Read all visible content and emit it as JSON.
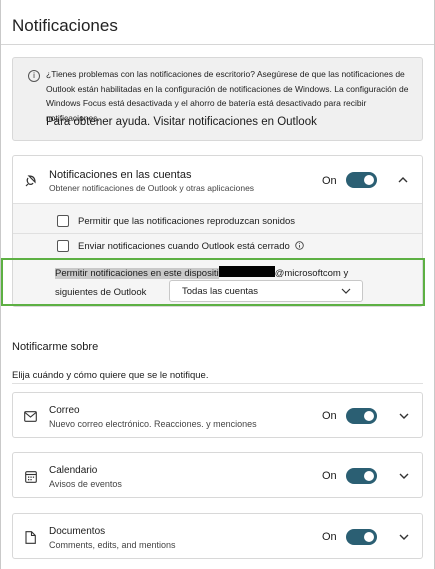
{
  "page": {
    "title": "Notificaciones"
  },
  "info_banner": {
    "icon": "info-icon",
    "text": "¿Tienes problemas con las notificaciones de escritorio? Asegúrese de que las notificaciones de Outlook están habilitadas en la configuración de notificaciones de Windows. La configuración de Windows Focus está desactivada y el ahorro de batería está desactivado para recibir notificaciones.",
    "help_text": "Para obtener ayuda. Visitar notificaciones en Outlook"
  },
  "accounts": {
    "icon": "notification-ring-icon",
    "title": "Notificaciones en las cuentas",
    "subtitle": "Obtener notificaciones de Outlook y otras aplicaciones",
    "on_label": "On",
    "toggle_on": true,
    "expanded": true,
    "options": [
      {
        "label": "Permitir que las notificaciones reproduzcan sonidos",
        "checked": false
      },
      {
        "label": "Enviar notificaciones cuando Outlook está cerrado",
        "checked": false
      }
    ],
    "device_setting": {
      "text_before": "Permitir notificaciones en este dispositi",
      "text_after": "@microsoftcom y",
      "text_line2": "siguientes de Outlook",
      "dropdown_value": "Todas las cuentas"
    }
  },
  "notify_section": {
    "title": "Notificarme sobre",
    "subtitle": "Elija cuándo y cómo quiere que se le notifique."
  },
  "notify_items": [
    {
      "icon": "mail-icon",
      "title": "Correo",
      "subtitle": "Nuevo correo electrónico. Reacciones. y menciones",
      "on_label": "On",
      "toggle_on": true
    },
    {
      "icon": "calendar-icon",
      "title": "Calendario",
      "subtitle": "Avisos de eventos",
      "on_label": "On",
      "toggle_on": true
    },
    {
      "icon": "document-icon",
      "title": "Documentos",
      "subtitle": "Comments, edits, and mentions",
      "on_label": "On",
      "toggle_on": true
    }
  ],
  "colors": {
    "toggle": "#2b5f73",
    "highlight_border": "#5db043"
  }
}
